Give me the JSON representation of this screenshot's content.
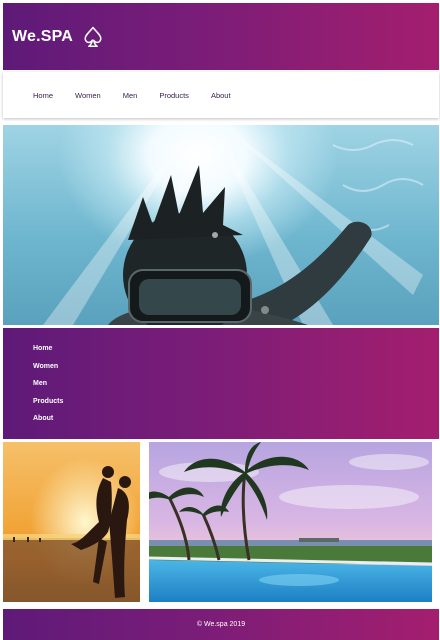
{
  "header": {
    "brand": "We.SPA",
    "logo_icon": "spade-outline-icon"
  },
  "top_nav": {
    "items": [
      "Home",
      "Women",
      "Men",
      "Products",
      "About"
    ]
  },
  "side_nav": {
    "items": [
      "Home",
      "Women",
      "Men",
      "Products",
      "About"
    ]
  },
  "hero": {
    "image": "underwater-selfie-diver-goggles"
  },
  "gallery": {
    "left_image": "couple-at-beach-sunset",
    "right_image": "palm-trees-pool-ocean-sunset"
  },
  "footer": {
    "text": "© We.spa 2019"
  },
  "colors": {
    "gradient_start": "#5e1a78",
    "gradient_end": "#a41e6e",
    "nav_text": "#3a2050"
  }
}
